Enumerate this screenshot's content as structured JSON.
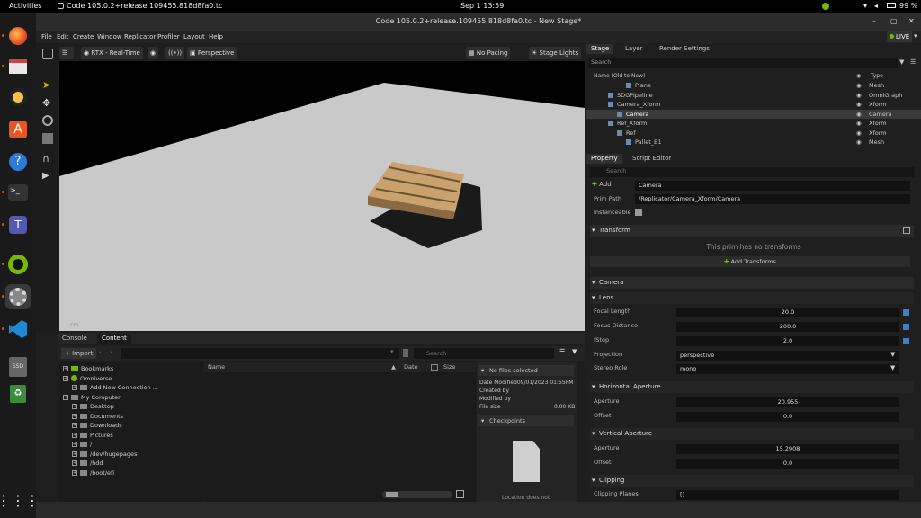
{
  "topbar": {
    "activities": "Activities",
    "app_title": "Code 105.0.2+release.109455.818d8fa0.tc",
    "clock": "Sep 1  13:59",
    "battery": "99 %"
  },
  "window": {
    "title": "Code 105.0.2+release.109455.818d8fa0.tc - New Stage*",
    "live": "LIVE"
  },
  "menu": [
    "File",
    "Edit",
    "Create",
    "Window",
    "Replicator",
    "Profiler",
    "Layout",
    "Help"
  ],
  "viewport_toolbar": {
    "renderer": "RTX - Real-Time",
    "camera": "Perspective",
    "pacing": "No Pacing",
    "lights": "Stage Lights"
  },
  "viewport": {
    "unit": "cm"
  },
  "bottom_tabs": [
    "Console",
    "Content"
  ],
  "content": {
    "import": "Import",
    "search_placeholder": "Search",
    "columns": {
      "name": "Name",
      "date": "Date",
      "size": "Size"
    }
  },
  "tree": [
    {
      "label": "Bookmarks",
      "indent": 0
    },
    {
      "label": "Omniverse",
      "indent": 0
    },
    {
      "label": "Add New Connection ...",
      "indent": 1
    },
    {
      "label": "My Computer",
      "indent": 0
    },
    {
      "label": "Desktop",
      "indent": 1
    },
    {
      "label": "Documents",
      "indent": 1
    },
    {
      "label": "Downloads",
      "indent": 1
    },
    {
      "label": "Pictures",
      "indent": 1
    },
    {
      "label": "/",
      "indent": 1
    },
    {
      "label": "/dev/hugepages",
      "indent": 1
    },
    {
      "label": "/hdd",
      "indent": 1
    },
    {
      "label": "/boot/efi",
      "indent": 1
    }
  ],
  "detail": {
    "header": "No files selected",
    "date_modified": "Date Modified09/01/2023 01:55PM",
    "created_by": "Created by",
    "modified_by": "Modified by",
    "file_size_label": "File size",
    "file_size": "0.00 KB",
    "checkpoints": "Checkpoints",
    "location": "Location does not"
  },
  "stage": {
    "tabs": [
      "Stage",
      "Layer",
      "Render Settings"
    ],
    "search": "Search",
    "col_name": "Name (Old to New)",
    "col_type": "Type",
    "rows": [
      {
        "name": "Plane",
        "type": "Mesh",
        "indent": 3
      },
      {
        "name": "SDGPipeline",
        "type": "OmniGraph",
        "indent": 1
      },
      {
        "name": "Camera_Xform",
        "type": "Xform",
        "indent": 1
      },
      {
        "name": "Camera",
        "type": "Camera",
        "indent": 2,
        "selected": true
      },
      {
        "name": "Ref_Xform",
        "type": "Xform",
        "indent": 1
      },
      {
        "name": "Ref",
        "type": "Xform",
        "indent": 2
      },
      {
        "name": "Pallet_B1",
        "type": "Mesh",
        "indent": 3
      }
    ]
  },
  "property": {
    "tabs": [
      "Property",
      "Script Editor"
    ],
    "search": "Search",
    "add": "Add",
    "prim_name": "Camera",
    "prim_path_label": "Prim Path",
    "prim_path": "/Replicator/Camera_Xform/Camera",
    "instanceable": "Instanceable",
    "transform": "Transform",
    "no_transform": "This prim has no transforms",
    "add_transforms": "Add Transforms",
    "camera": "Camera",
    "lens": "Lens",
    "focal_length_label": "Focal Length",
    "focal_length": "20.0",
    "focus_distance_label": "Focus Distance",
    "focus_distance": "200.0",
    "fstop_label": "fStop",
    "fstop": "2.0",
    "projection_label": "Projection",
    "projection": "perspective",
    "stereo_label": "Stereo Role",
    "stereo": "mono",
    "h_aperture": "Horizontal Aperture",
    "aperture_label": "Aperture",
    "h_aperture_value": "20.955",
    "offset_label": "Offset",
    "h_offset": "0.0",
    "v_aperture": "Vertical Aperture",
    "v_aperture_value": "15.2908",
    "v_offset": "0.0",
    "clipping": "Clipping",
    "clipping_planes": "Clipping Planes",
    "clipping_value": "[]"
  },
  "colors": {
    "accent": "#76b900",
    "live": "#76b900",
    "selection": "#3a3a3a",
    "slider": "#3d7fc4"
  }
}
